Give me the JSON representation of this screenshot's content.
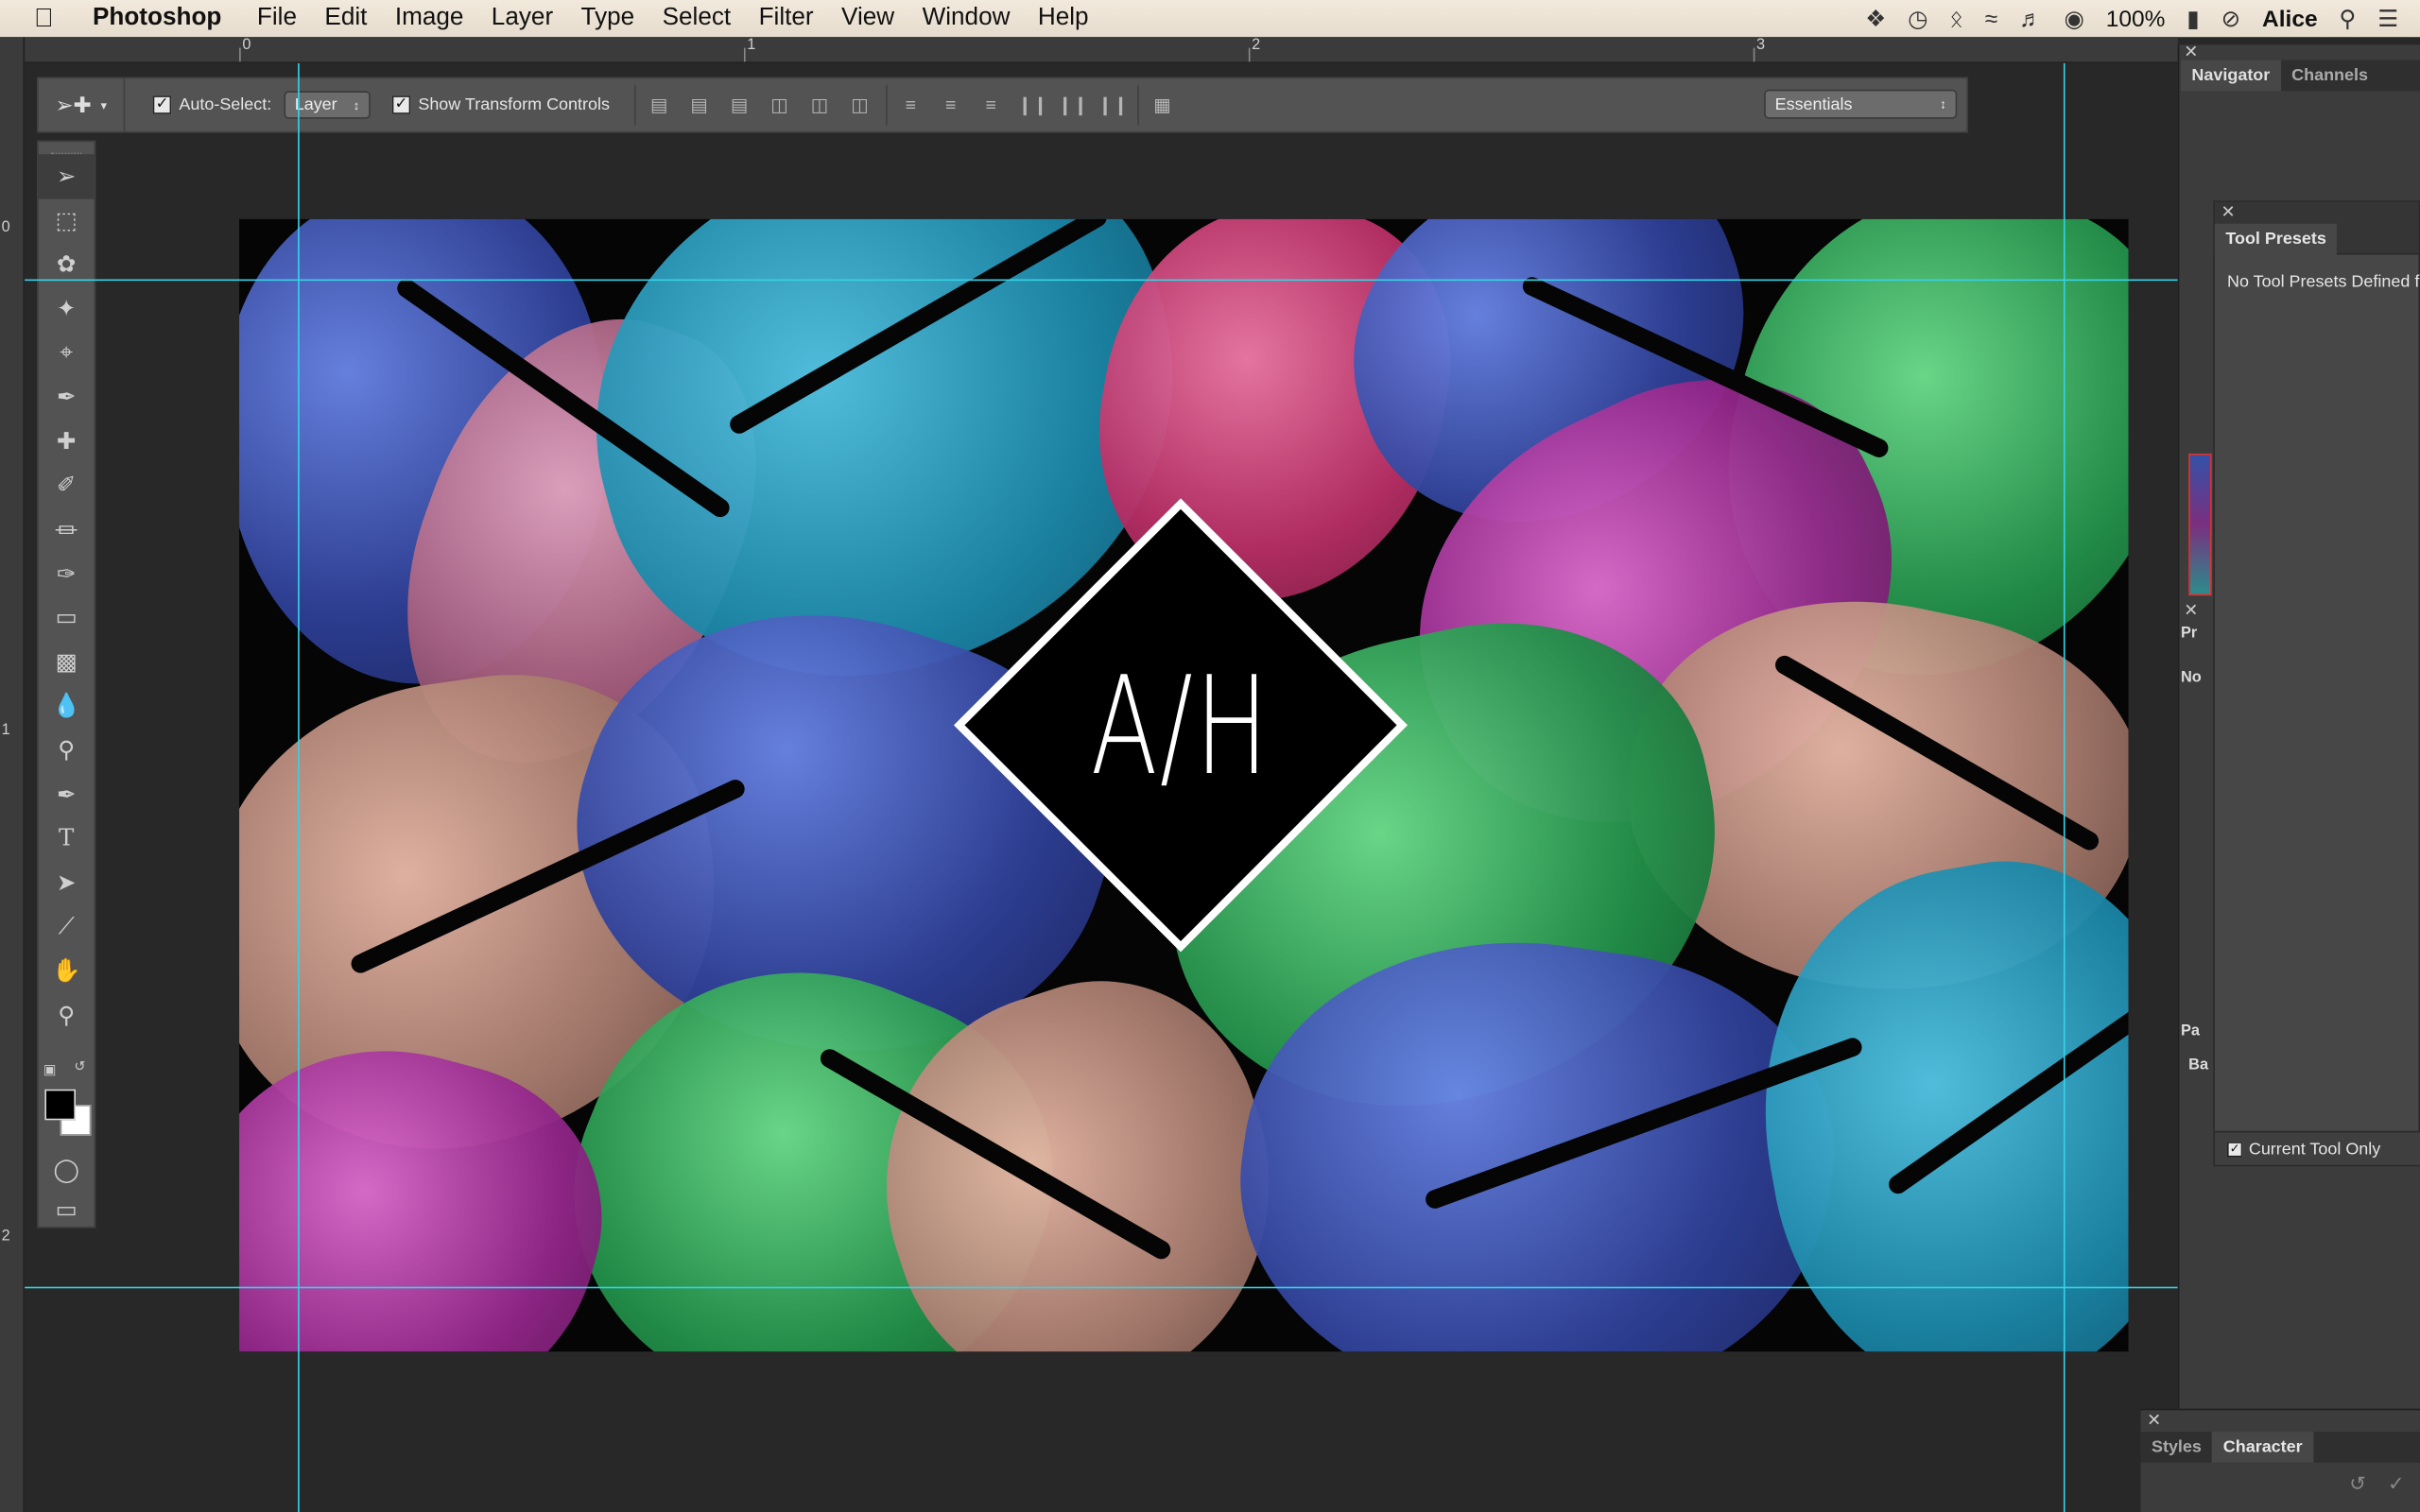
{
  "menubar": {
    "app_name": "Photoshop",
    "items": [
      "File",
      "Edit",
      "Image",
      "Layer",
      "Type",
      "Select",
      "Filter",
      "View",
      "Window",
      "Help"
    ],
    "battery": "100%",
    "user": "Alice"
  },
  "ruler": {
    "top_ticks": [
      "0",
      "1",
      "2",
      "3"
    ],
    "left_ticks": [
      "0",
      "1",
      "2"
    ]
  },
  "options_bar": {
    "auto_select_label": "Auto-Select:",
    "auto_select_checked": true,
    "auto_select_target": "Layer",
    "transform_controls_label": "Show Transform Controls",
    "transform_controls_checked": true,
    "workspace": "Essentials"
  },
  "canvas": {
    "monogram": "A/H",
    "guide_color": "#35d2e6"
  },
  "panels": {
    "navigator_tab": "Navigator",
    "channels_tab": "Channels",
    "tool_presets_title": "Tool Presets",
    "tool_presets_message": "No Tool Presets Defined fo",
    "current_tool_only": "Current Tool Only",
    "strip_labels": [
      "Pr",
      "No",
      "Pa",
      "Ba"
    ],
    "bottom_tabs": [
      "Styles",
      "Character"
    ]
  }
}
